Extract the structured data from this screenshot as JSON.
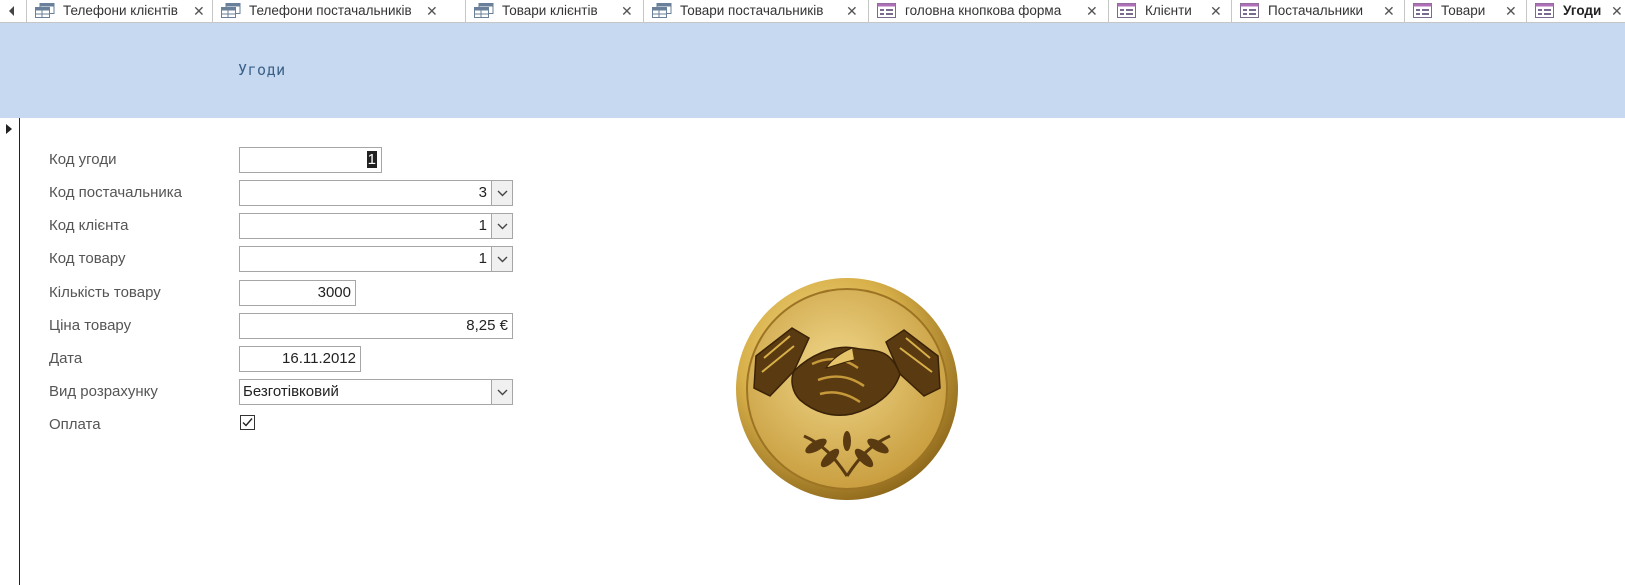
{
  "tabs": [
    {
      "label": "Телефони клієнтів",
      "kind": "table"
    },
    {
      "label": "Телефони постачальників",
      "kind": "table"
    },
    {
      "label": "Товари клієнтів",
      "kind": "table"
    },
    {
      "label": "Товари постачальників",
      "kind": "table"
    },
    {
      "label": "головна кнопкова форма",
      "kind": "form"
    },
    {
      "label": "Клієнти",
      "kind": "form"
    },
    {
      "label": "Постачальники",
      "kind": "form"
    },
    {
      "label": "Товари",
      "kind": "form"
    },
    {
      "label": "Угоди",
      "kind": "form",
      "active": true
    }
  ],
  "form": {
    "title": "Угоди",
    "fields": {
      "code_deal": {
        "label": "Код угоди",
        "value": "1"
      },
      "code_supplier": {
        "label": "Код постачальника",
        "value": "3"
      },
      "code_client": {
        "label": "Код клієнта",
        "value": "1"
      },
      "code_product": {
        "label": "Код товару",
        "value": "1"
      },
      "quantity": {
        "label": "Кількість товару",
        "value": "3000"
      },
      "price": {
        "label": "Ціна товару",
        "value": "8,25 €"
      },
      "date": {
        "label": "Дата",
        "value": "16.11.2012"
      },
      "payment_type": {
        "label": "Вид розрахунку",
        "value": "Безготівковий"
      },
      "paid": {
        "label": "Оплата",
        "checked": true
      }
    }
  },
  "icons": {
    "table": "table-icon",
    "form": "form-icon",
    "close": "close-icon",
    "dropdown": "chevron-down-icon",
    "record_selector": "record-selector-arrow-icon",
    "emblem": "handshake-emblem-icon"
  },
  "colors": {
    "header_bg": "#c6d9f1",
    "title": "#3a5f86",
    "emblem_gold": "#d8b04a"
  }
}
